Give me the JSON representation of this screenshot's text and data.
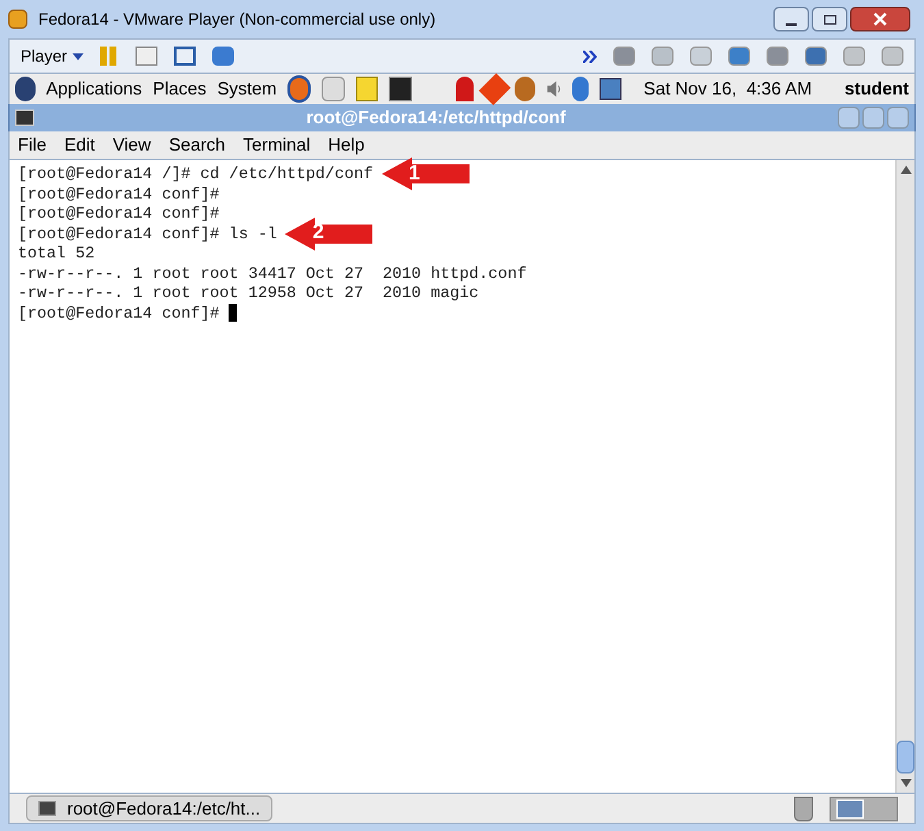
{
  "window": {
    "title": "Fedora14 - VMware Player (Non-commercial use only)"
  },
  "toolbar": {
    "player_menu": "Player"
  },
  "panel": {
    "menus": [
      "Applications",
      "Places",
      "System"
    ],
    "clock": "Sat Nov 16,  4:36 AM",
    "user": "student"
  },
  "terminal": {
    "title": "root@Fedora14:/etc/httpd/conf",
    "menu": [
      "File",
      "Edit",
      "View",
      "Search",
      "Terminal",
      "Help"
    ],
    "lines": [
      {
        "text": "[root@Fedora14 /]# cd /etc/httpd/conf",
        "callout": "1"
      },
      {
        "text": "[root@Fedora14 conf]#"
      },
      {
        "text": "[root@Fedora14 conf]#"
      },
      {
        "text": "[root@Fedora14 conf]# ls -l",
        "callout": "2"
      },
      {
        "text": "total 52"
      },
      {
        "text": "-rw-r--r--. 1 root root 34417 Oct 27  2010 httpd.conf"
      },
      {
        "text": "-rw-r--r--. 1 root root 12958 Oct 27  2010 magic"
      },
      {
        "text": "[root@Fedora14 conf]# "
      }
    ],
    "cursor_visible": true
  },
  "taskbar": {
    "task": "root@Fedora14:/etc/ht..."
  }
}
